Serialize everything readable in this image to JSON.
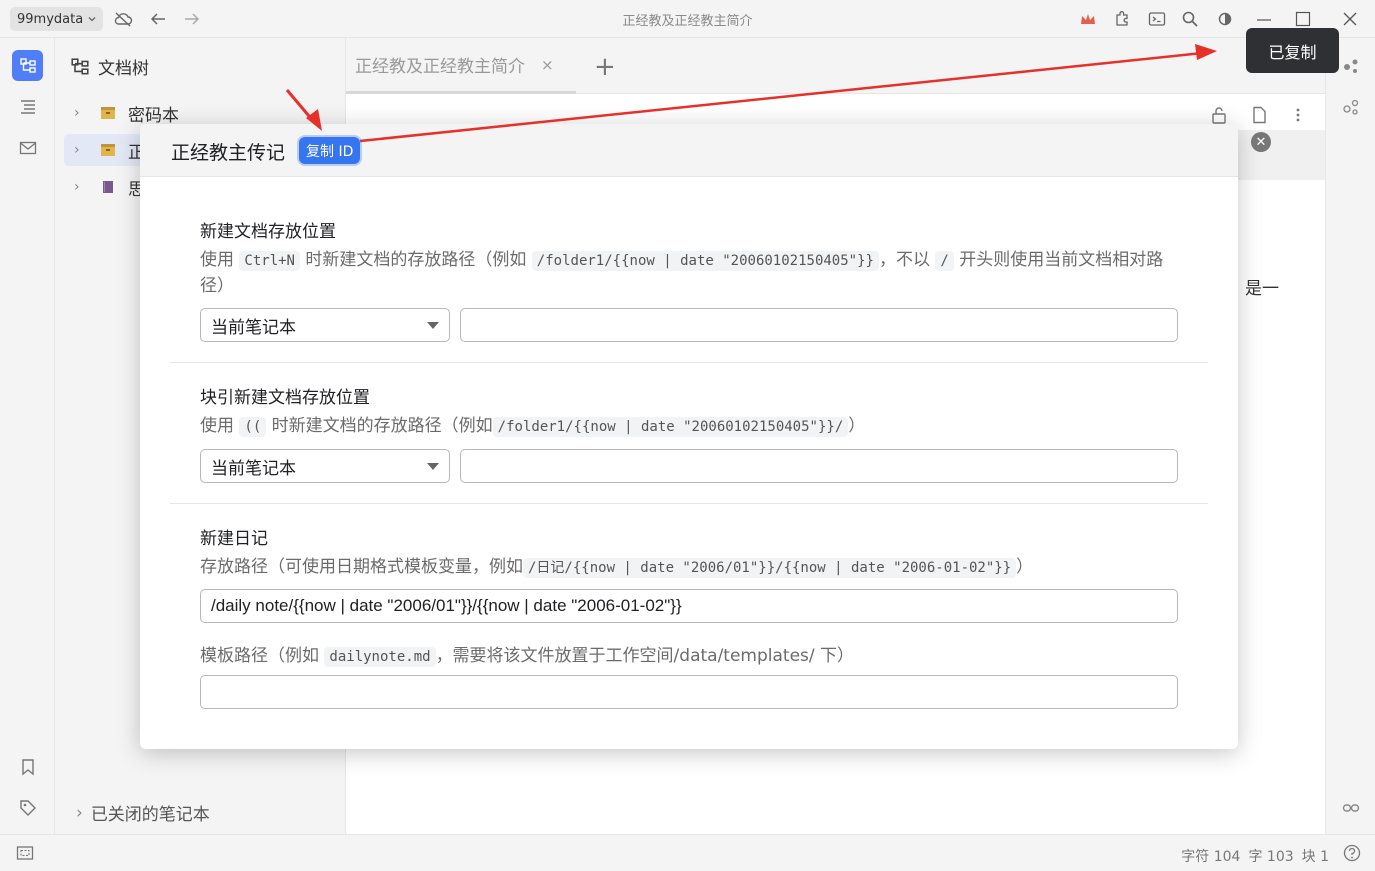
{
  "window": {
    "workspace": "99mydata",
    "title": "正经教及正经教主简介",
    "tooltip": "已复制"
  },
  "sidebar": {
    "header": "文档树",
    "items": [
      {
        "label": "密码本"
      },
      {
        "label": "正"
      },
      {
        "label": "思"
      }
    ],
    "closed_notebooks": "已关闭的笔记本"
  },
  "editor": {
    "tab_label": "正经教及正经教主简介",
    "visible_text": "是一"
  },
  "status": {
    "chars": "字符 104",
    "words": "字 103",
    "blocks": "块 1"
  },
  "dialog": {
    "title": "正经教主传记",
    "copy_id_label": "复制 ID",
    "section1": {
      "title": "新建文档存放位置",
      "desc_a": "使用",
      "code_a": "Ctrl+N",
      "desc_b": "时新建文档的存放路径（例如",
      "code_b": "/folder1/{{now | date \"20060102150405\"}}",
      "desc_c": "，不以",
      "code_c": "/",
      "desc_d": "开头则使用当前文档相对路径）",
      "select_value": "当前笔记本",
      "input_value": ""
    },
    "section2": {
      "title": "块引新建文档存放位置",
      "desc_a": "使用",
      "code_a": "((",
      "desc_b": "时新建文档的存放路径（例如",
      "code_b": "/folder1/{{now | date \"20060102150405\"}}/",
      "desc_c": "）",
      "select_value": "当前笔记本",
      "input_value": ""
    },
    "section3": {
      "title": "新建日记",
      "desc_a": "存放路径（可使用日期格式模板变量，例如",
      "code_a": "/日记/{{now | date \"2006/01\"}}/{{now | date \"2006-01-02\"}}",
      "desc_b": "）",
      "path_value": "/daily note/{{now | date \"2006/01\"}}/{{now | date \"2006-01-02\"}}",
      "template_desc_a": "模板路径（例如",
      "template_code": "dailynote.md",
      "template_desc_b": "，需要将该文件放置于工作空间/data/templates/ 下）",
      "template_value": ""
    }
  }
}
